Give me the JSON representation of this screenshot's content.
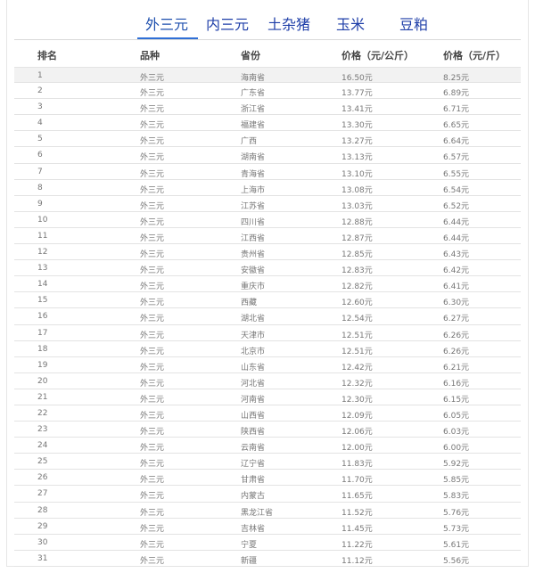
{
  "tabs": [
    {
      "label": "外三元",
      "active": true
    },
    {
      "label": "内三元",
      "active": false
    },
    {
      "label": "土杂猪",
      "active": false
    },
    {
      "label": "玉米",
      "active": false
    },
    {
      "label": "豆粕",
      "active": false
    }
  ],
  "table": {
    "headers": [
      "排名",
      "品种",
      "省份",
      "价格（元/公斤）",
      "价格（元/斤）"
    ],
    "rows": [
      [
        "1",
        "外三元",
        "海南省",
        "16.50元",
        "8.25元"
      ],
      [
        "2",
        "外三元",
        "广东省",
        "13.77元",
        "6.89元"
      ],
      [
        "3",
        "外三元",
        "浙江省",
        "13.41元",
        "6.71元"
      ],
      [
        "4",
        "外三元",
        "福建省",
        "13.30元",
        "6.65元"
      ],
      [
        "5",
        "外三元",
        "广西",
        "13.27元",
        "6.64元"
      ],
      [
        "6",
        "外三元",
        "湖南省",
        "13.13元",
        "6.57元"
      ],
      [
        "7",
        "外三元",
        "青海省",
        "13.10元",
        "6.55元"
      ],
      [
        "8",
        "外三元",
        "上海市",
        "13.08元",
        "6.54元"
      ],
      [
        "9",
        "外三元",
        "江苏省",
        "13.03元",
        "6.52元"
      ],
      [
        "10",
        "外三元",
        "四川省",
        "12.88元",
        "6.44元"
      ],
      [
        "11",
        "外三元",
        "江西省",
        "12.87元",
        "6.44元"
      ],
      [
        "12",
        "外三元",
        "贵州省",
        "12.85元",
        "6.43元"
      ],
      [
        "13",
        "外三元",
        "安徽省",
        "12.83元",
        "6.42元"
      ],
      [
        "14",
        "外三元",
        "重庆市",
        "12.82元",
        "6.41元"
      ],
      [
        "15",
        "外三元",
        "西藏",
        "12.60元",
        "6.30元"
      ],
      [
        "16",
        "外三元",
        "湖北省",
        "12.54元",
        "6.27元"
      ],
      [
        "17",
        "外三元",
        "天津市",
        "12.51元",
        "6.26元"
      ],
      [
        "18",
        "外三元",
        "北京市",
        "12.51元",
        "6.26元"
      ],
      [
        "19",
        "外三元",
        "山东省",
        "12.42元",
        "6.21元"
      ],
      [
        "20",
        "外三元",
        "河北省",
        "12.32元",
        "6.16元"
      ],
      [
        "21",
        "外三元",
        "河南省",
        "12.30元",
        "6.15元"
      ],
      [
        "22",
        "外三元",
        "山西省",
        "12.09元",
        "6.05元"
      ],
      [
        "23",
        "外三元",
        "陕西省",
        "12.06元",
        "6.03元"
      ],
      [
        "24",
        "外三元",
        "云南省",
        "12.00元",
        "6.00元"
      ],
      [
        "25",
        "外三元",
        "辽宁省",
        "11.83元",
        "5.92元"
      ],
      [
        "26",
        "外三元",
        "甘肃省",
        "11.70元",
        "5.85元"
      ],
      [
        "27",
        "外三元",
        "内蒙古",
        "11.65元",
        "5.83元"
      ],
      [
        "28",
        "外三元",
        "黑龙江省",
        "11.52元",
        "5.76元"
      ],
      [
        "29",
        "外三元",
        "吉林省",
        "11.45元",
        "5.73元"
      ],
      [
        "30",
        "外三元",
        "宁夏",
        "11.22元",
        "5.61元"
      ],
      [
        "31",
        "外三元",
        "新疆",
        "11.12元",
        "5.56元"
      ]
    ]
  },
  "colors": {
    "tab_text": "#1e3ea8",
    "tab_underline": "#2f6fd6",
    "first_row_bg": "#f2f2f2",
    "row_border": "#e3e3e3"
  }
}
